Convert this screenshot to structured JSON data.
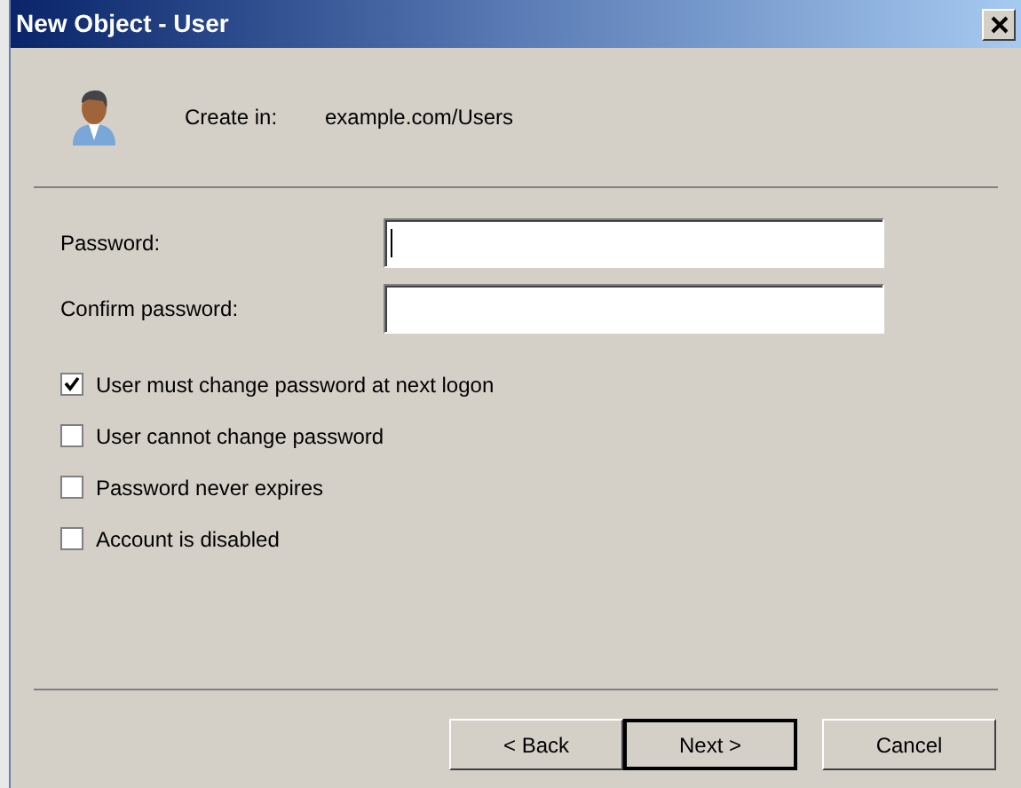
{
  "window": {
    "title": "New Object - User"
  },
  "header": {
    "label": "Create in:",
    "value": "example.com/Users"
  },
  "fields": [
    {
      "label": "Password:",
      "focused": true
    },
    {
      "label": "Confirm password:",
      "focused": false
    }
  ],
  "options": [
    {
      "label": "User must change password at next logon",
      "checked": true
    },
    {
      "label": "User cannot change password",
      "checked": false
    },
    {
      "label": "Password never expires",
      "checked": false
    },
    {
      "label": "Account is disabled",
      "checked": false
    }
  ],
  "buttons": [
    {
      "label": "< Back",
      "default": false
    },
    {
      "label": "Next >",
      "default": true
    },
    {
      "label": "Cancel",
      "default": false
    }
  ]
}
